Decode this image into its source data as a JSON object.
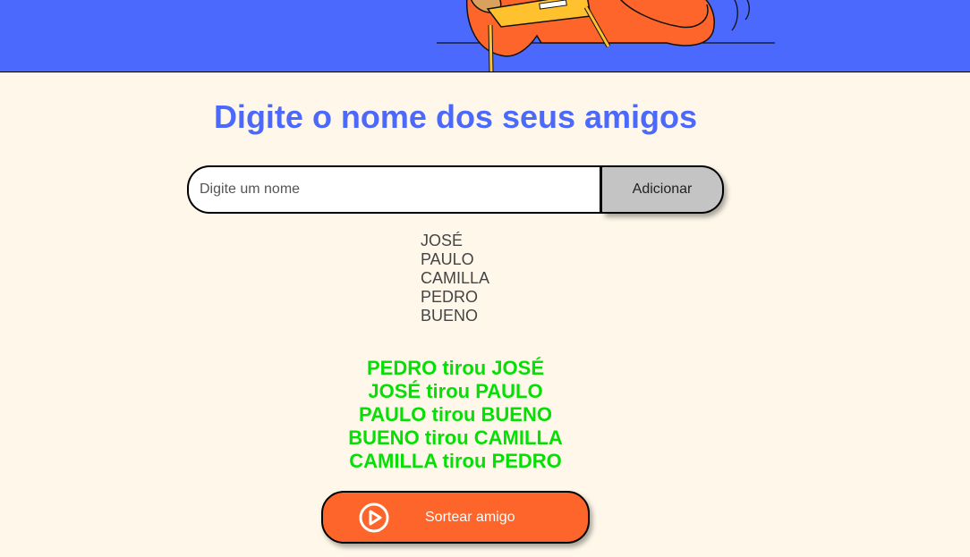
{
  "header": {
    "illustration": "person-with-sign-illustration"
  },
  "main": {
    "title": "Digite o nome dos seus amigos"
  },
  "form": {
    "input_placeholder": "Digite um nome",
    "input_value": "",
    "add_label": "Adicionar"
  },
  "friends": [
    "JOSÉ",
    "PAULO",
    "CAMILLA",
    "PEDRO",
    "BUENO"
  ],
  "results": [
    "PEDRO tirou JOSÉ",
    "JOSÉ tirou PAULO",
    "PAULO tirou BUENO",
    "BUENO tirou CAMILLA",
    "CAMILLA tirou PEDRO"
  ],
  "draw_button": {
    "label": "Sortear amigo",
    "icon": "play-circle-icon"
  },
  "colors": {
    "banner": "#4b69fd",
    "title": "#4b69fd",
    "background": "#fff8ea",
    "result_text": "#05df05",
    "draw_button": "#fe652b",
    "add_button": "#c4c4c4"
  }
}
